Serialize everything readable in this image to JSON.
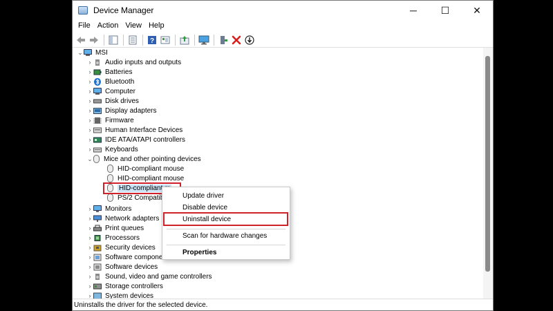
{
  "window": {
    "title": "Device Manager"
  },
  "window_controls": {
    "minimize": "─",
    "maximize": "☐",
    "close": "✕"
  },
  "menu": [
    "File",
    "Action",
    "View",
    "Help"
  ],
  "tree": {
    "root": "MSI",
    "categories": [
      "Audio inputs and outputs",
      "Batteries",
      "Bluetooth",
      "Computer",
      "Disk drives",
      "Display adapters",
      "Firmware",
      "Human Interface Devices",
      "IDE ATA/ATAPI controllers",
      "Keyboards",
      "Mice and other pointing devices"
    ],
    "mice_children": [
      "HID-compliant mouse",
      "HID-compliant mouse",
      "HID-compliant m",
      "PS/2 Compatible"
    ],
    "categories_after": [
      "Monitors",
      "Network adapters",
      "Print queues",
      "Processors",
      "Security devices",
      "Software componen",
      "Software devices",
      "Sound, video and game controllers",
      "Storage controllers",
      "System devices"
    ]
  },
  "context_menu": {
    "items": [
      "Update driver",
      "Disable device",
      "Uninstall device",
      "Scan for hardware changes",
      "Properties"
    ]
  },
  "status": "Uninstalls the driver for the selected device.",
  "colors": {
    "highlight": "#d0202a",
    "selection": "#cce4f7"
  }
}
